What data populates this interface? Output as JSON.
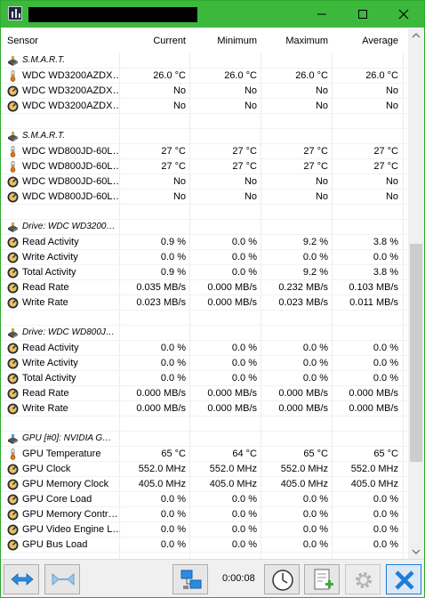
{
  "window": {
    "title": ""
  },
  "columns": [
    "Sensor",
    "Current",
    "Minimum",
    "Maximum",
    "Average"
  ],
  "rows": [
    {
      "type": "group",
      "icon": "hdd-icon",
      "name": "S.M.A.R.T."
    },
    {
      "type": "sensor",
      "icon": "thermometer-icon",
      "name": "WDC WD3200AZDX…",
      "current": "26.0 °C",
      "minimum": "26.0 °C",
      "maximum": "26.0 °C",
      "average": "26.0 °C"
    },
    {
      "type": "sensor",
      "icon": "gauge-icon",
      "name": "WDC WD3200AZDX…",
      "current": "No",
      "minimum": "No",
      "maximum": "No",
      "average": "No"
    },
    {
      "type": "sensor",
      "icon": "gauge-icon",
      "name": "WDC WD3200AZDX…",
      "current": "No",
      "minimum": "No",
      "maximum": "No",
      "average": "No"
    },
    {
      "type": "blank"
    },
    {
      "type": "group",
      "icon": "hdd-icon",
      "name": "S.M.A.R.T."
    },
    {
      "type": "sensor",
      "icon": "thermometer-icon",
      "name": "WDC WD800JD-60L…",
      "current": "27 °C",
      "minimum": "27 °C",
      "maximum": "27 °C",
      "average": "27 °C"
    },
    {
      "type": "sensor",
      "icon": "thermometer-icon",
      "name": "WDC WD800JD-60L…",
      "current": "27 °C",
      "minimum": "27 °C",
      "maximum": "27 °C",
      "average": "27 °C"
    },
    {
      "type": "sensor",
      "icon": "gauge-icon",
      "name": "WDC WD800JD-60L…",
      "current": "No",
      "minimum": "No",
      "maximum": "No",
      "average": "No"
    },
    {
      "type": "sensor",
      "icon": "gauge-icon",
      "name": "WDC WD800JD-60L…",
      "current": "No",
      "minimum": "No",
      "maximum": "No",
      "average": "No"
    },
    {
      "type": "blank"
    },
    {
      "type": "group",
      "icon": "hdd-icon",
      "name": "Drive: WDC WD3200…"
    },
    {
      "type": "sensor",
      "icon": "gauge-icon",
      "name": "Read Activity",
      "current": "0.9 %",
      "minimum": "0.0 %",
      "maximum": "9.2 %",
      "average": "3.8 %"
    },
    {
      "type": "sensor",
      "icon": "gauge-icon",
      "name": "Write Activity",
      "current": "0.0 %",
      "minimum": "0.0 %",
      "maximum": "0.0 %",
      "average": "0.0 %"
    },
    {
      "type": "sensor",
      "icon": "gauge-icon",
      "name": "Total Activity",
      "current": "0.9 %",
      "minimum": "0.0 %",
      "maximum": "9.2 %",
      "average": "3.8 %"
    },
    {
      "type": "sensor",
      "icon": "gauge-icon",
      "name": "Read Rate",
      "current": "0.035 MB/s",
      "minimum": "0.000 MB/s",
      "maximum": "0.232 MB/s",
      "average": "0.103 MB/s"
    },
    {
      "type": "sensor",
      "icon": "gauge-icon",
      "name": "Write Rate",
      "current": "0.023 MB/s",
      "minimum": "0.000 MB/s",
      "maximum": "0.023 MB/s",
      "average": "0.011 MB/s"
    },
    {
      "type": "blank"
    },
    {
      "type": "group",
      "icon": "hdd-icon",
      "name": "Drive: WDC WD800J…"
    },
    {
      "type": "sensor",
      "icon": "gauge-icon",
      "name": "Read Activity",
      "current": "0.0 %",
      "minimum": "0.0 %",
      "maximum": "0.0 %",
      "average": "0.0 %"
    },
    {
      "type": "sensor",
      "icon": "gauge-icon",
      "name": "Write Activity",
      "current": "0.0 %",
      "minimum": "0.0 %",
      "maximum": "0.0 %",
      "average": "0.0 %"
    },
    {
      "type": "sensor",
      "icon": "gauge-icon",
      "name": "Total Activity",
      "current": "0.0 %",
      "minimum": "0.0 %",
      "maximum": "0.0 %",
      "average": "0.0 %"
    },
    {
      "type": "sensor",
      "icon": "gauge-icon",
      "name": "Read Rate",
      "current": "0.000 MB/s",
      "minimum": "0.000 MB/s",
      "maximum": "0.000 MB/s",
      "average": "0.000 MB/s"
    },
    {
      "type": "sensor",
      "icon": "gauge-icon",
      "name": "Write Rate",
      "current": "0.000 MB/s",
      "minimum": "0.000 MB/s",
      "maximum": "0.000 MB/s",
      "average": "0.000 MB/s"
    },
    {
      "type": "blank"
    },
    {
      "type": "group",
      "icon": "gpu-icon",
      "name": "GPU [#0]: NVIDIA G…"
    },
    {
      "type": "sensor",
      "icon": "thermometer-icon",
      "name": "GPU Temperature",
      "current": "65 °C",
      "minimum": "64 °C",
      "maximum": "65 °C",
      "average": "65 °C"
    },
    {
      "type": "sensor",
      "icon": "gauge-icon",
      "name": "GPU Clock",
      "current": "552.0 MHz",
      "minimum": "552.0 MHz",
      "maximum": "552.0 MHz",
      "average": "552.0 MHz"
    },
    {
      "type": "sensor",
      "icon": "gauge-icon",
      "name": "GPU Memory Clock",
      "current": "405.0 MHz",
      "minimum": "405.0 MHz",
      "maximum": "405.0 MHz",
      "average": "405.0 MHz"
    },
    {
      "type": "sensor",
      "icon": "gauge-icon",
      "name": "GPU Core Load",
      "current": "0.0 %",
      "minimum": "0.0 %",
      "maximum": "0.0 %",
      "average": "0.0 %"
    },
    {
      "type": "sensor",
      "icon": "gauge-icon",
      "name": "GPU Memory Contr…",
      "current": "0.0 %",
      "minimum": "0.0 %",
      "maximum": "0.0 %",
      "average": "0.0 %"
    },
    {
      "type": "sensor",
      "icon": "gauge-icon",
      "name": "GPU Video Engine L…",
      "current": "0.0 %",
      "minimum": "0.0 %",
      "maximum": "0.0 %",
      "average": "0.0 %"
    },
    {
      "type": "sensor",
      "icon": "gauge-icon",
      "name": "GPU Bus Load",
      "current": "0.0 %",
      "minimum": "0.0 %",
      "maximum": "0.0 %",
      "average": "0.0 %"
    }
  ],
  "bottombar": {
    "timer": "0:00:08",
    "buttons": [
      "expand-arrows-icon",
      "collapse-arrows-icon",
      "network-icon",
      "clock-icon",
      "add-report-icon",
      "settings-gear-icon",
      "close-x-icon"
    ]
  },
  "colors": {
    "titlebar": "#3cb93c",
    "accent": "#1e7dd8"
  }
}
